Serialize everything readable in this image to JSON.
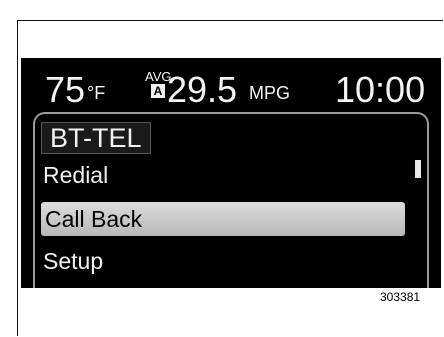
{
  "status_bar": {
    "temperature": "75",
    "temperature_unit": "°F",
    "avg_label": "AVG.",
    "avg_badge": "A",
    "fuel_economy": "29.5",
    "fuel_economy_unit": "MPG",
    "clock": "10:00"
  },
  "menu": {
    "title": "BT-TEL",
    "items": [
      {
        "label": "Redial"
      },
      {
        "label": "Call Back"
      },
      {
        "label": "Setup"
      }
    ],
    "selected_index": 1
  },
  "figure_code": "303381",
  "colors": {
    "screen_background": "#000000",
    "text": "#f0f0f0",
    "selection_highlight": "#c8c8c8"
  }
}
